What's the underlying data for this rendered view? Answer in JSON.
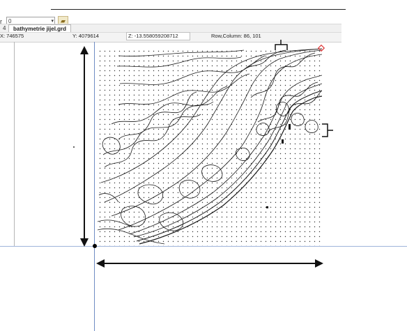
{
  "toolbar": {
    "left_label": "r",
    "combo_value": "0",
    "combo_arrow": "▾",
    "folder_icon": "folder-open-icon"
  },
  "tabs": {
    "index_label": "4",
    "active_tab": "bathymetrie jijel.grd"
  },
  "status": {
    "x": "X: 746575",
    "y": "Y: 4079614",
    "z": "Z: -13.558059208712",
    "rowcol": "Row,Column:  86, 101"
  },
  "colors": {
    "accent_guides": "#6f8cc4",
    "corner_marker": "#e03a3a",
    "contour": "#1a1a1a"
  },
  "grid": {
    "show_nodes": true,
    "corner_marker": "diamond-red"
  }
}
